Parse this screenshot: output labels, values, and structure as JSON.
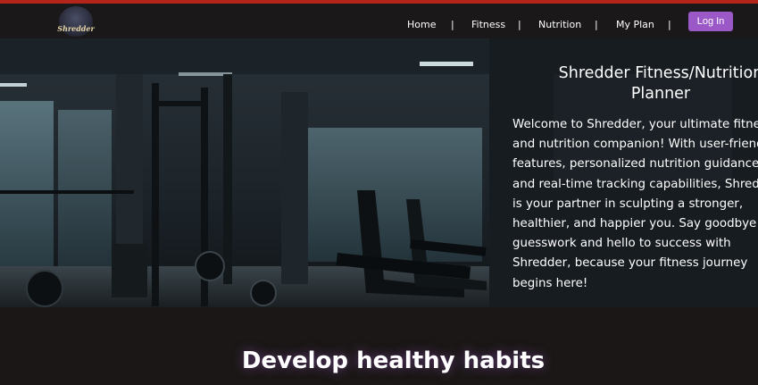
{
  "nav": {
    "logo_text": "Shredder",
    "links": [
      "Home",
      "Fitness",
      "Nutrition",
      "My Plan"
    ],
    "separator": "|",
    "login_label": "Log In"
  },
  "hero": {
    "title_line1": "Shredder Fitness/Nutrition",
    "title_line2": "Planner",
    "body_lines": [
      "Welcome to Shredder, your ultimate fitness",
      "and nutrition companion! With user-friendly",
      "features, personalized nutrition guidance,",
      "and real-time tracking capabilities, Shredder",
      "is your partner in sculpting a stronger,",
      "healthier, and happier you. Say goodbye to",
      "guesswork and hello to success with",
      "Shredder, because your fitness journey",
      "begins here!"
    ]
  },
  "section": {
    "heading": "Develop healthy habits"
  },
  "colors": {
    "accent_bar": "#b3241b",
    "login_button": "#9b59c7",
    "background": "#1b1716"
  }
}
